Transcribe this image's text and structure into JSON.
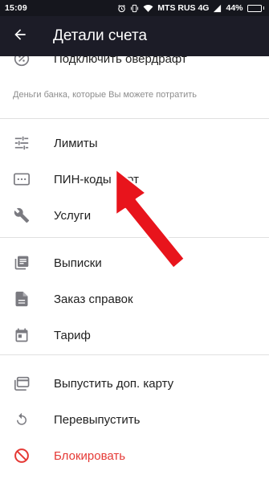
{
  "status_bar": {
    "time": "15:09",
    "carrier": "MTS RUS 4G",
    "battery": "44%",
    "battery_level": 0.44
  },
  "app_bar": {
    "title": "Детали счета",
    "back_icon": "arrow-left-icon"
  },
  "menu": {
    "overdraft_label": "Подключить овердрафт",
    "overdraft_hint": "Деньги банка, которые Вы можете потратить",
    "section1": [
      {
        "label": "Лимиты",
        "icon": "sliders-icon"
      },
      {
        "label": "ПИН-коды карт",
        "icon": "pin-code-icon"
      },
      {
        "label": "Услуги",
        "icon": "wrench-icon"
      }
    ],
    "section2": [
      {
        "label": "Выписки",
        "icon": "statements-icon"
      },
      {
        "label": "Заказ справок",
        "icon": "document-icon"
      },
      {
        "label": "Тариф",
        "icon": "calendar-icon"
      }
    ],
    "section3": [
      {
        "label": "Выпустить доп. карту",
        "icon": "card-icon"
      },
      {
        "label": "Перевыпустить",
        "icon": "reissue-icon"
      },
      {
        "label": "Блокировать",
        "icon": "block-icon"
      }
    ]
  },
  "colors": {
    "status_bar_bg": "#15161d",
    "app_bar_bg": "#1c1c27",
    "icon_gray": "#7a7a80",
    "danger_red": "#e53935",
    "annotation_arrow": "#e8141c"
  }
}
